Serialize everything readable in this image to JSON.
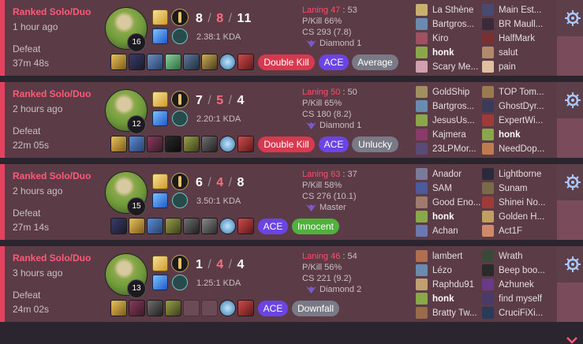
{
  "matches": [
    {
      "queue": "Ranked Solo/Duo",
      "time_ago": "1 hour ago",
      "result": "Defeat",
      "duration": "37m 48s",
      "champion_level": "16",
      "kills": "8",
      "deaths": "8",
      "assists": "11",
      "kda_ratio": "2.38:1 KDA",
      "laning_label": "Laning 47",
      "laning_opp": ": 53",
      "pkill": "P/Kill 66%",
      "cs": "CS 293 (7.8)",
      "rank": "Diamond 1",
      "badges": [
        {
          "label": "Double Kill",
          "color": "red"
        },
        {
          "label": "ACE",
          "color": "purple"
        },
        {
          "label": "Average",
          "color": "grey"
        }
      ],
      "team1": [
        "La Sthène",
        "Bartgros...",
        "Kiro",
        "honk",
        "Scary Me..."
      ],
      "team2": [
        "Main Est...",
        "BR Maull...",
        "HalfMark",
        "salut",
        "pain"
      ]
    },
    {
      "queue": "Ranked Solo/Duo",
      "time_ago": "2 hours ago",
      "result": "Defeat",
      "duration": "22m 05s",
      "champion_level": "12",
      "kills": "7",
      "deaths": "5",
      "assists": "4",
      "kda_ratio": "2.20:1 KDA",
      "laning_label": "Laning 50",
      "laning_opp": ": 50",
      "pkill": "P/Kill 65%",
      "cs": "CS 180 (8.2)",
      "rank": "Diamond 1",
      "badges": [
        {
          "label": "Double Kill",
          "color": "red"
        },
        {
          "label": "ACE",
          "color": "purple"
        },
        {
          "label": "Unlucky",
          "color": "grey"
        }
      ],
      "team1": [
        "GoldShip",
        "Bartgros...",
        "JesusUs...",
        "Kajmera",
        "23LPMor..."
      ],
      "team2": [
        "TOP Tom...",
        "GhostDyr...",
        "ExpertWi...",
        "honk",
        "NeedDop..."
      ]
    },
    {
      "queue": "Ranked Solo/Duo",
      "time_ago": "2 hours ago",
      "result": "Defeat",
      "duration": "27m 14s",
      "champion_level": "15",
      "kills": "6",
      "deaths": "4",
      "assists": "8",
      "kda_ratio": "3.50:1 KDA",
      "laning_label": "Laning 63",
      "laning_opp": ": 37",
      "pkill": "P/Kill 58%",
      "cs": "CS 276 (10.1)",
      "rank": "Master",
      "badges": [
        {
          "label": "ACE",
          "color": "purple"
        },
        {
          "label": "Innocent",
          "color": "green"
        }
      ],
      "team1": [
        "Anador",
        "SAM",
        "Good Eno...",
        "honk",
        "Achan"
      ],
      "team2": [
        "Lightborne",
        "Sunam",
        "Shinei No...",
        "Golden H...",
        "Act1F"
      ]
    },
    {
      "queue": "Ranked Solo/Duo",
      "time_ago": "3 hours ago",
      "result": "Defeat",
      "duration": "24m 02s",
      "champion_level": "13",
      "kills": "1",
      "deaths": "4",
      "assists": "4",
      "kda_ratio": "1.25:1 KDA",
      "laning_label": "Laning 46",
      "laning_opp": ": 54",
      "pkill": "P/Kill 56%",
      "cs": "CS 221 (9.2)",
      "rank": "Diamond 2",
      "badges": [
        {
          "label": "ACE",
          "color": "purple"
        },
        {
          "label": "Downfall",
          "color": "grey"
        }
      ],
      "team1": [
        "lambert",
        "Lézo",
        "Raphdu91",
        "honk",
        "Bratty Tw..."
      ],
      "team2": [
        "Wrath",
        "Beep boo...",
        "Azhunek",
        "find myself",
        "CruciFiXi..."
      ]
    }
  ],
  "highlight_player": "honk",
  "icons": [
    "flash-icon",
    "ghost-icon",
    "keystone-rune-icon",
    "secondary-rune-icon",
    "item-icon",
    "ward-icon",
    "rank-emblem-icon",
    "settings-cog-icon",
    "chevron-down-icon"
  ],
  "colors": {
    "accent_red": "#e4415e",
    "card_bg": "#5b3b46",
    "ace": "#6b45e3",
    "double_kill": "#d8394f",
    "innocent": "#4fb23a"
  }
}
